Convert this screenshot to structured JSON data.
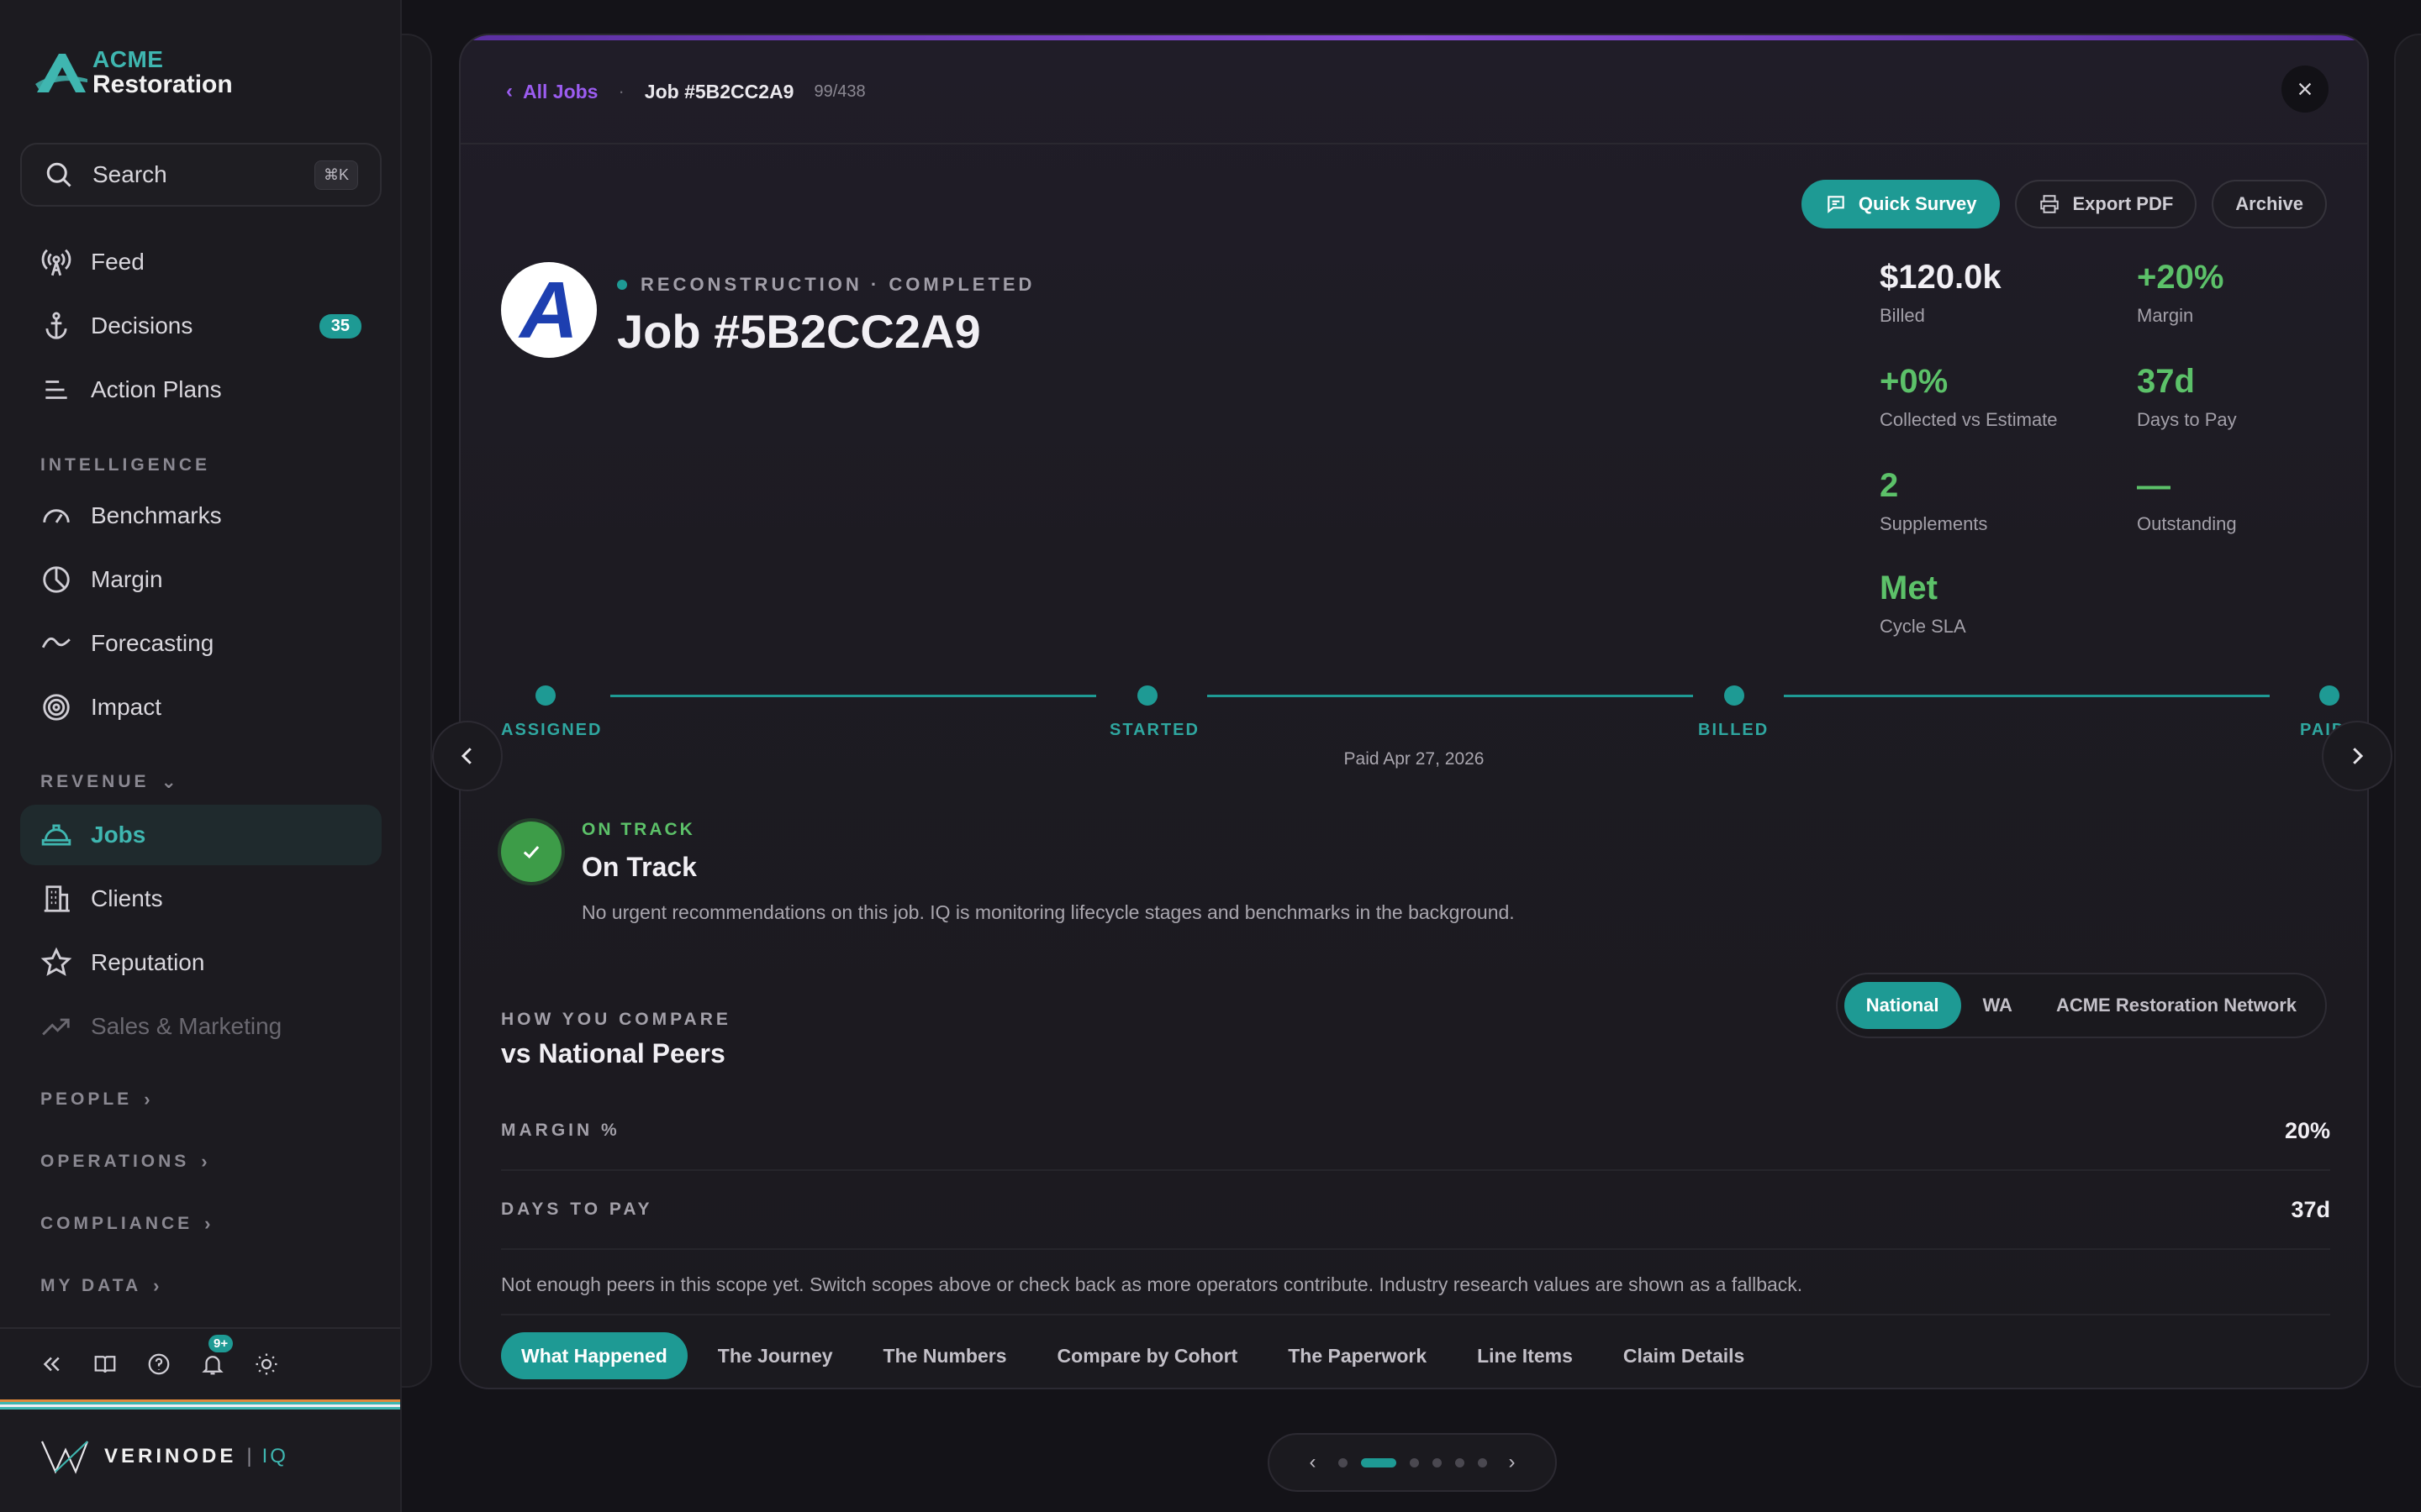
{
  "brand": {
    "line1": "ACME",
    "line2": "Restoration"
  },
  "search": {
    "placeholder": "Search",
    "shortcut": "⌘K"
  },
  "sidebar": {
    "top_items": [
      {
        "label": "Feed",
        "icon": "broadcast-icon"
      },
      {
        "label": "Decisions",
        "icon": "anchor-icon",
        "badge": "35"
      },
      {
        "label": "Action Plans",
        "icon": "list-icon"
      }
    ],
    "sections": {
      "intelligence": "INTELLIGENCE",
      "revenue": "REVENUE",
      "people": "PEOPLE",
      "operations": "OPERATIONS",
      "compliance": "COMPLIANCE",
      "my_data": "MY DATA"
    },
    "intelligence_items": [
      {
        "label": "Benchmarks",
        "icon": "gauge-icon"
      },
      {
        "label": "Margin",
        "icon": "pie-icon"
      },
      {
        "label": "Forecasting",
        "icon": "trend-icon"
      },
      {
        "label": "Impact",
        "icon": "target-icon"
      }
    ],
    "revenue_items": [
      {
        "label": "Jobs",
        "icon": "hardhat-icon",
        "active": true
      },
      {
        "label": "Clients",
        "icon": "building-icon"
      },
      {
        "label": "Reputation",
        "icon": "star-icon"
      },
      {
        "label": "Sales & Marketing",
        "icon": "chart-up-icon",
        "muted": true
      }
    ],
    "footer": {
      "notif_badge": "9+"
    },
    "vendor": {
      "name": "VERINODE",
      "sep": "|",
      "product": "IQ"
    }
  },
  "modal": {
    "breadcrumb": {
      "back": "All Jobs",
      "current": "Job #5B2CC2A9",
      "count": "99/438"
    },
    "actions": {
      "survey": "Quick Survey",
      "export": "Export PDF",
      "archive": "Archive"
    },
    "job": {
      "subtitle": "RECONSTRUCTION · COMPLETED",
      "title": "Job #5B2CC2A9",
      "avatar_letter": "A"
    },
    "stats": [
      {
        "value": "$120.0k",
        "label": "Billed"
      },
      {
        "value": "+20%",
        "label": "Margin"
      },
      {
        "value": "+0%",
        "label": "Collected vs Estimate"
      },
      {
        "value": "37d",
        "label": "Days to Pay"
      },
      {
        "value": "2",
        "label": "Supplements"
      },
      {
        "value": "—",
        "label": "Outstanding"
      },
      {
        "value": "Met",
        "label": "Cycle SLA"
      }
    ],
    "timeline": {
      "stages": [
        "ASSIGNED",
        "STARTED",
        "BILLED",
        "PAID"
      ],
      "note": "Paid Apr 27, 2026"
    },
    "status": {
      "eyebrow": "ON TRACK",
      "title": "On Track",
      "text": "No urgent recommendations on this job. IQ is monitoring lifecycle stages and benchmarks in the background."
    },
    "compare": {
      "eyebrow": "HOW YOU COMPARE",
      "title": "vs National Peers",
      "scopes": [
        "National",
        "WA",
        "ACME Restoration Network"
      ],
      "rows": [
        {
          "label": "MARGIN %",
          "value": "20%"
        },
        {
          "label": "DAYS TO PAY",
          "value": "37d"
        }
      ],
      "fallback": "Not enough peers in this scope yet. Switch scopes above or check back as more operators contribute. Industry research values are shown as a fallback."
    },
    "tabs": [
      "What Happened",
      "The Journey",
      "The Numbers",
      "Compare by Cohort",
      "The Paperwork",
      "Line Items",
      "Claim Details"
    ]
  },
  "pager": {
    "pages": 6,
    "current": 1
  },
  "colors": {
    "accent": "#1e9a94",
    "positive": "#5cc169",
    "brand_purple": "#9b5cf0"
  }
}
